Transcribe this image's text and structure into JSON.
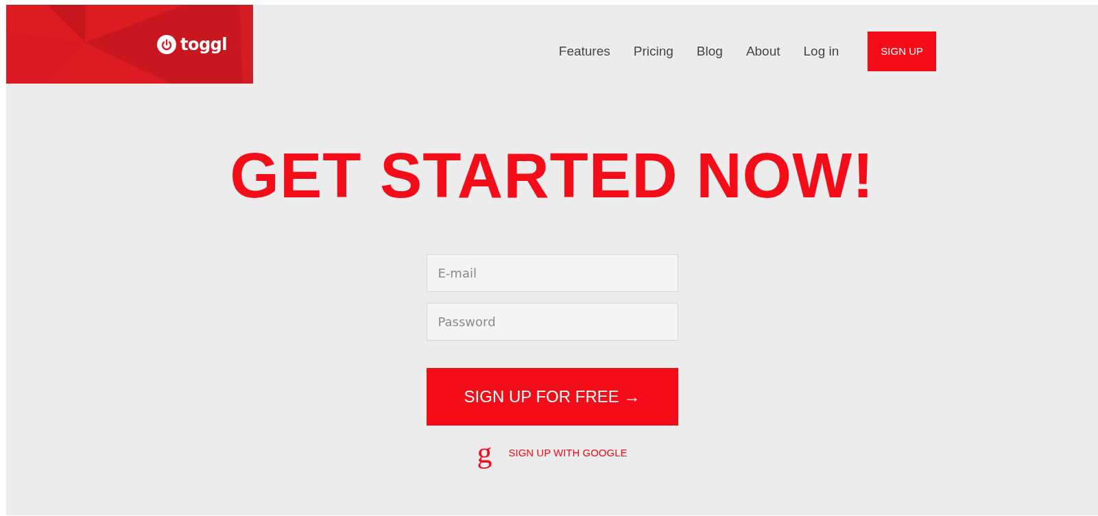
{
  "logo": {
    "text": "toggl"
  },
  "nav": [
    {
      "label": "Features",
      "kind": "link"
    },
    {
      "label": "Pricing",
      "kind": "link"
    },
    {
      "label": "Blog",
      "kind": "link"
    },
    {
      "label": "About",
      "kind": "link"
    },
    {
      "label": "Log in",
      "kind": "link"
    },
    {
      "label": "SIGN UP",
      "kind": "button"
    }
  ],
  "heading": "GET STARTED NOW!",
  "fields": [
    {
      "placeholder": "E-mail"
    },
    {
      "placeholder": "Password"
    }
  ],
  "submit": "SIGN UP FOR FREE →",
  "google": {
    "glyph": "g",
    "label": "SIGN UP WITH GOOGLE"
  }
}
